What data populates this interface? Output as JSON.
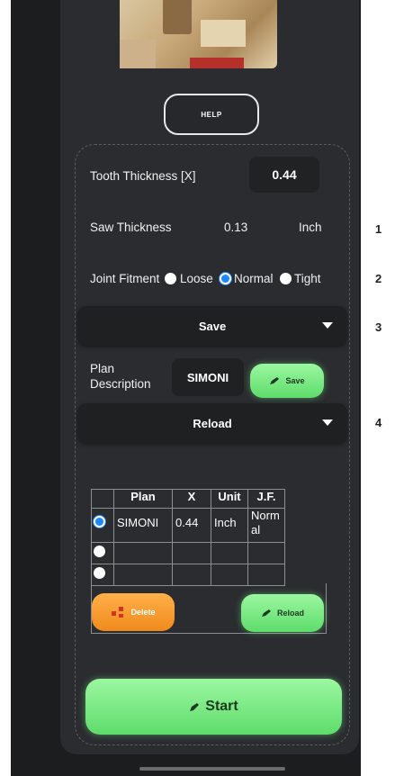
{
  "help_label": "HELP",
  "tooth": {
    "label": "Tooth Thickness [X]",
    "value": "0.44"
  },
  "saw": {
    "label": "Saw Thickness",
    "value": "0.13",
    "unit": "Inch"
  },
  "fitment": {
    "label": "Joint Fitment",
    "options": [
      "Loose",
      "Normal",
      "Tight"
    ],
    "selected": "Normal"
  },
  "save_dropdown": "Save",
  "plan": {
    "label_line1": "Plan",
    "label_line2": "Description",
    "value": "SIMONI",
    "save_button": "Save"
  },
  "reload_dropdown": "Reload",
  "table": {
    "headers": [
      "Plan",
      "X",
      "Unit",
      "J.F."
    ],
    "rows": [
      {
        "plan": "SIMONI",
        "x": "0.44",
        "unit": "Inch",
        "jf_line1": "Norm",
        "jf_line2": "al",
        "selected": true
      },
      {
        "plan": "",
        "x": "",
        "unit": "",
        "jf_line1": "",
        "jf_line2": "",
        "selected": false
      },
      {
        "plan": "",
        "x": "",
        "unit": "",
        "jf_line1": "",
        "jf_line2": "",
        "selected": false
      }
    ]
  },
  "delete_button": "Delete",
  "reload_button": "Reload",
  "start_button": "Start",
  "markers": [
    "1",
    "2",
    "3",
    "4"
  ],
  "colors": {
    "accent_green": "#6fe07a",
    "accent_orange": "#f5961f",
    "radio_blue": "#1e88ff"
  }
}
